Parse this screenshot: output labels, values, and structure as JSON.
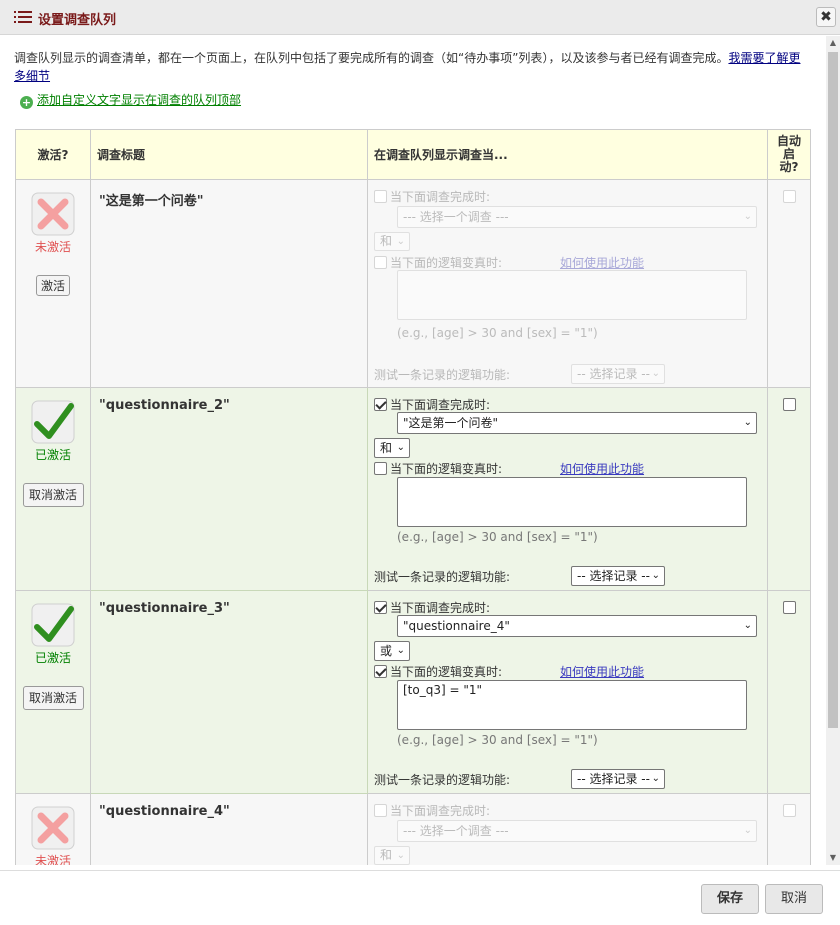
{
  "dialog": {
    "title": "设置调查队列",
    "close_label": "✖"
  },
  "intro": {
    "text": "调查队列显示的调查清单，都在一个页面上，在队列中包括了要完成所有的调查（如“待办事项”列表），以及该参与者已经有调查完成。",
    "link": "我需要了解更多细节"
  },
  "add_custom_text_link": "添加自定义文字显示在调查的队列顶部",
  "table": {
    "headers": {
      "active": "激活?",
      "title": "调查标题",
      "display_when": "在调查队列显示调查当...",
      "autostart": "自动启动?"
    }
  },
  "labels": {
    "when_complete": "当下面调查完成时:",
    "when_logic": "当下面的逻辑变真时:",
    "how_to_use": "如何使用此功能",
    "example": "(e.g., [age] > 30 and [sex] = \"1\")",
    "test_logic": "测试一条记录的逻辑功能:",
    "select_record": "-- 选择记录 --",
    "select_survey": "--- 选择一个调查 ---",
    "inactive": "未激活",
    "active": "已激活",
    "activate_btn": "激活",
    "deactivate_btn": "取消激活"
  },
  "rows": [
    {
      "title": "\"这是第一个问卷\"",
      "active": false,
      "complete_checked": false,
      "survey": "--- 选择一个调查 ---",
      "andor": "和",
      "logic_checked": false,
      "logic": ""
    },
    {
      "title": "\"questionnaire_2\"",
      "active": true,
      "complete_checked": true,
      "survey": "\"这是第一个问卷\"",
      "andor": "和",
      "logic_checked": false,
      "logic": "",
      "autostart": false
    },
    {
      "title": "\"questionnaire_3\"",
      "active": true,
      "complete_checked": true,
      "survey": "\"questionnaire_4\"",
      "andor": "或",
      "logic_checked": true,
      "logic": "[to_q3] = \"1\"",
      "autostart": false
    },
    {
      "title": "\"questionnaire_4\"",
      "active": false,
      "complete_checked": false,
      "survey": "--- 选择一个调查 ---",
      "andor": "和"
    }
  ],
  "footer": {
    "save": "保存",
    "cancel": "取消"
  },
  "colors": {
    "title": "#7a1a1a",
    "active_green": "#008000",
    "inactive_red": "#e05050",
    "header_bg": "#ffffe0",
    "active_row_bg": "#eef5e7"
  },
  "icons": {
    "title": "list-icon",
    "inactive": "x-mark-icon",
    "active": "check-mark-icon",
    "add": "plus-circle-icon"
  }
}
